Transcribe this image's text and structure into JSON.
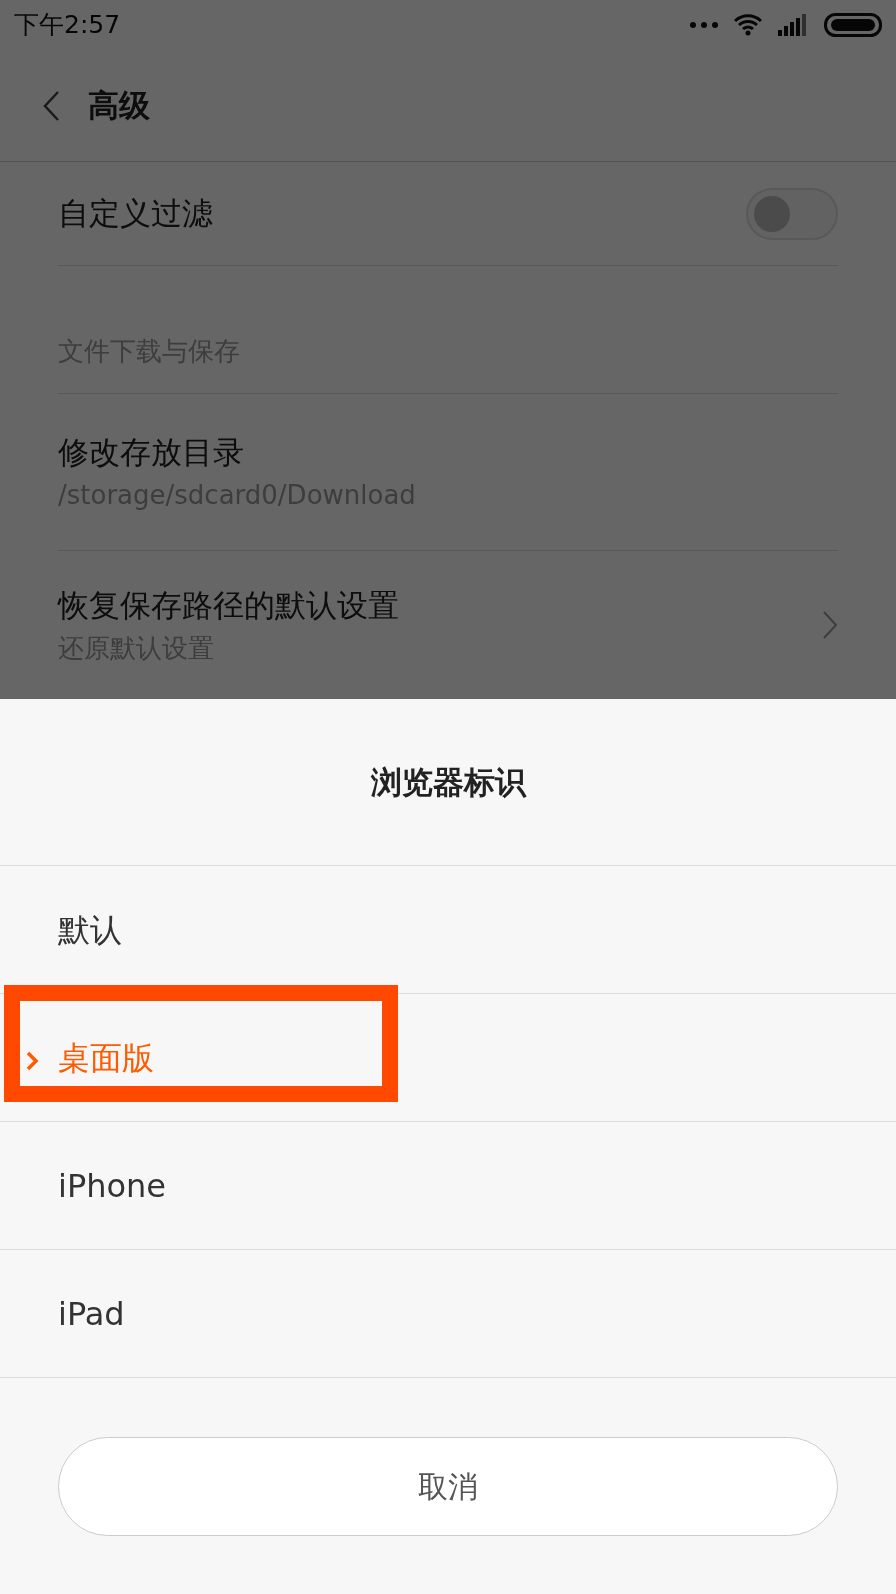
{
  "status_bar": {
    "time": "下午2:57"
  },
  "header": {
    "title": "高级"
  },
  "settings": [
    {
      "kind": "toggle",
      "label": "自定义过滤",
      "on": false
    },
    {
      "kind": "section",
      "label": "文件下载与保存"
    },
    {
      "kind": "detail",
      "label": "修改存放目录",
      "subtitle": "/storage/sdcard0/Download"
    },
    {
      "kind": "link",
      "label": "恢复保存路径的默认设置",
      "subtitle": "还原默认设置"
    }
  ],
  "dialog": {
    "title": "浏览器标识",
    "options": [
      {
        "label": "默认",
        "selected": false,
        "annotated": false
      },
      {
        "label": "桌面版",
        "selected": true,
        "annotated": true
      },
      {
        "label": "iPhone",
        "selected": false,
        "annotated": false
      },
      {
        "label": "iPad",
        "selected": false,
        "annotated": false
      }
    ],
    "cancel": "取消"
  }
}
